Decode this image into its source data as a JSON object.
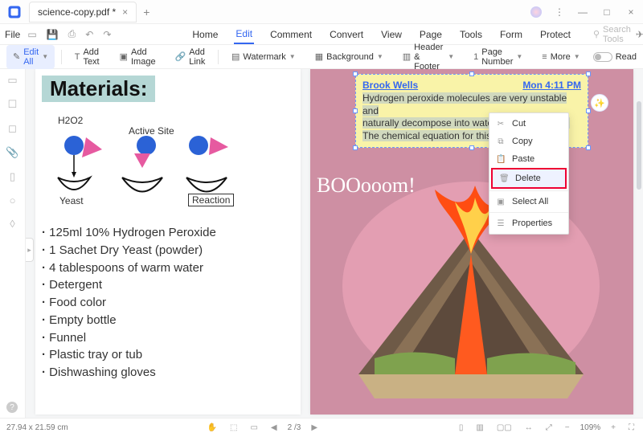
{
  "tab_title": "science-copy.pdf *",
  "menubar": {
    "file": "File"
  },
  "ribbon": {
    "tabs": [
      "Home",
      "Edit",
      "Comment",
      "Convert",
      "View",
      "Page",
      "Tools",
      "Form",
      "Protect"
    ],
    "active_index": 1,
    "search_placeholder": "Search Tools"
  },
  "toolbar": {
    "edit_all": "Edit All",
    "add_text": "Add Text",
    "add_image": "Add Image",
    "add_link": "Add Link",
    "watermark": "Watermark",
    "background": "Background",
    "header_footer": "Header & Footer",
    "page_number": "Page Number",
    "more": "More",
    "read": "Read"
  },
  "page_left": {
    "heading": "Materials:",
    "labels": {
      "h2o2": "H2O2",
      "active_site": "Active Site",
      "yeast": "Yeast",
      "reaction": "Reaction"
    },
    "items": [
      "125ml 10% Hydrogen Peroxide",
      "1 Sachet Dry Yeast (powder)",
      "4 tablespoons of warm water",
      "Detergent",
      "Food color",
      "Empty bottle",
      "Funnel",
      "Plastic tray or tub",
      "Dishwashing gloves"
    ]
  },
  "note": {
    "author": "Brook Wells",
    "time": "Mon 4:11 PM",
    "body_line1": "Hydrogen peroxide molecules are very unstable and",
    "body_line2": "naturally decompose into water and oxygen gas.",
    "body_line3": "The chemical equation for this decomposition is:"
  },
  "context_menu": {
    "cut": "Cut",
    "copy": "Copy",
    "paste": "Paste",
    "delete": "Delete",
    "select_all": "Select All",
    "properties": "Properties"
  },
  "boom_text": "BOOooom!",
  "status": {
    "dimensions": "27.94 x 21.59 cm",
    "page": "2 /3",
    "zoom": "109%"
  }
}
